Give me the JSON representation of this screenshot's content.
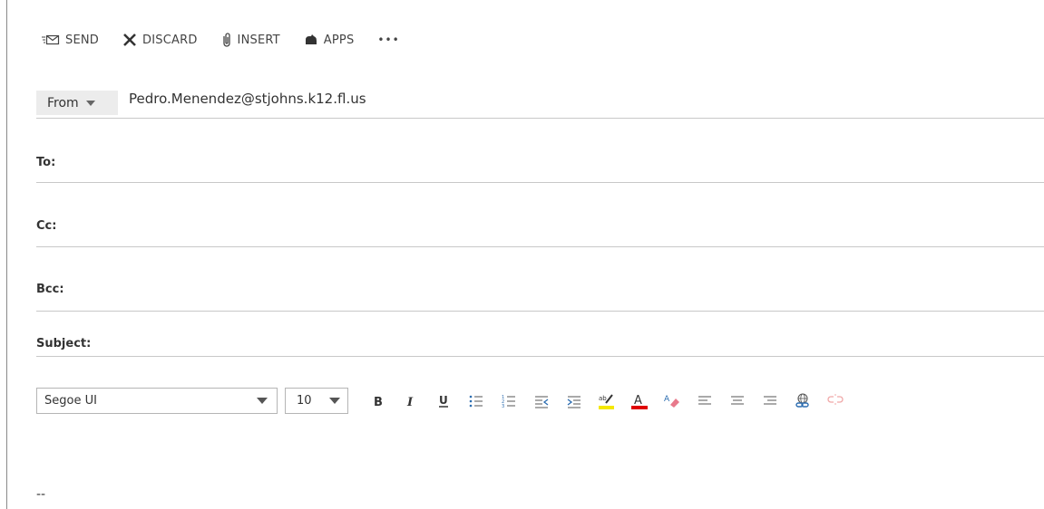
{
  "toolbar": {
    "send_label": "SEND",
    "discard_label": "DISCARD",
    "insert_label": "INSERT",
    "apps_label": "APPS",
    "more_label": "•••"
  },
  "header": {
    "from_label": "From",
    "from_address": "Pedro.Menendez@stjohns.k12.fl.us",
    "to_label": "To:",
    "cc_label": "Cc:",
    "bcc_label": "Bcc:",
    "subject_label": "Subject:"
  },
  "format": {
    "font_family": "Segoe UI",
    "font_size": "10",
    "highlight_color": "#f5e800",
    "font_color": "#e00000",
    "icons": [
      "bold-icon",
      "italic-icon",
      "underline-icon",
      "bullets-icon",
      "numbering-icon",
      "decrease-indent-icon",
      "increase-indent-icon",
      "highlight-icon",
      "font-color-icon",
      "clear-formatting-icon",
      "align-left-icon",
      "align-center-icon",
      "align-right-icon",
      "insert-link-icon",
      "remove-link-icon"
    ]
  },
  "body": {
    "signature_dash": "--"
  }
}
